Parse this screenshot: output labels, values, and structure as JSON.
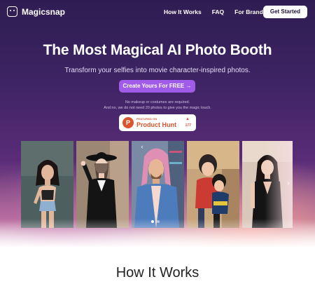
{
  "brand": {
    "name": "Magicsnap"
  },
  "nav": {
    "links": [
      "How It Works",
      "FAQ",
      "For Brands"
    ],
    "cta": "Get Started"
  },
  "hero": {
    "title": "The Most Magical AI Photo Booth",
    "subtitle": "Transform your selfies into movie character-inspired photos.",
    "cta": "Create Yours For FREE",
    "cta_arrow": "→",
    "note_line1": "No makeup or costumes are required.",
    "note_line2": "And no, we do not need 20 photos to give you the magic touch."
  },
  "product_hunt": {
    "logo_letter": "P",
    "featured": "FEATURED ON",
    "name": "Product Hunt",
    "upvote_icon": "▲",
    "count": "177"
  },
  "gallery": {
    "photos": [
      "woman-denim-shorts-portrait",
      "woman-black-hat-portrait",
      "man-pink-hair-portrait",
      "animated-couple-portrait",
      "woman-black-dress-portrait"
    ],
    "prev_icon": "‹",
    "next_icon": "›",
    "active_slide": 1,
    "slide_count": 2
  },
  "how_it_works": {
    "title": "How It Works"
  },
  "colors": {
    "accent": "#a05be8",
    "hero_top": "#2e1d52",
    "product_hunt": "#d9542f"
  }
}
